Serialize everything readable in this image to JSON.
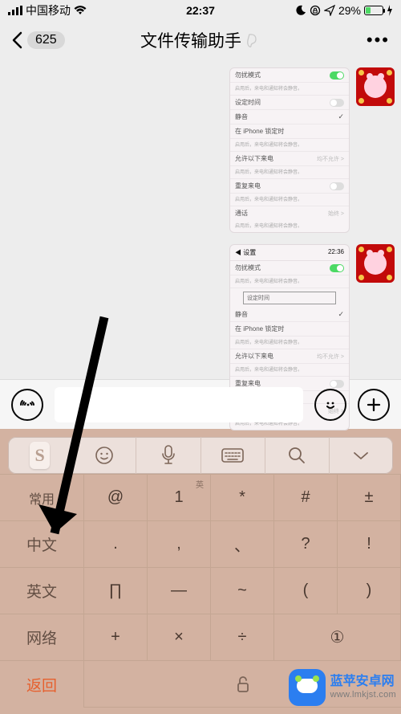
{
  "status": {
    "signal_label": "中国移动",
    "time": "22:37",
    "battery_pct": "29%"
  },
  "header": {
    "unread": "625",
    "title": "文件传输助手"
  },
  "bubble": {
    "head_left": "设置",
    "head_right": "22:36",
    "mode_label": "勿扰模式",
    "sel_label": "设定时间",
    "row_quiet": "静音",
    "row_iphone": "在 iPhone 锁定时",
    "allowrow": "允许以下来电",
    "summary": "重复来电",
    "bottom1": "通话",
    "bottom2": "启用后，来电和通知将会静音。"
  },
  "kb": {
    "side": [
      "常用",
      "中文",
      "英文",
      "网络",
      "返回"
    ],
    "r1": [
      "@",
      "1",
      "*",
      "#",
      "±"
    ],
    "r1_sup": "英",
    "r2": [
      ".",
      ",",
      "、",
      "?",
      "!"
    ],
    "r3": [
      "∏",
      "—",
      "~",
      "(",
      ")"
    ],
    "r4": [
      "+",
      "×",
      "÷",
      "①"
    ]
  },
  "watermark": {
    "name": "蓝苹安卓网",
    "url": "www.lmkjst.com"
  }
}
